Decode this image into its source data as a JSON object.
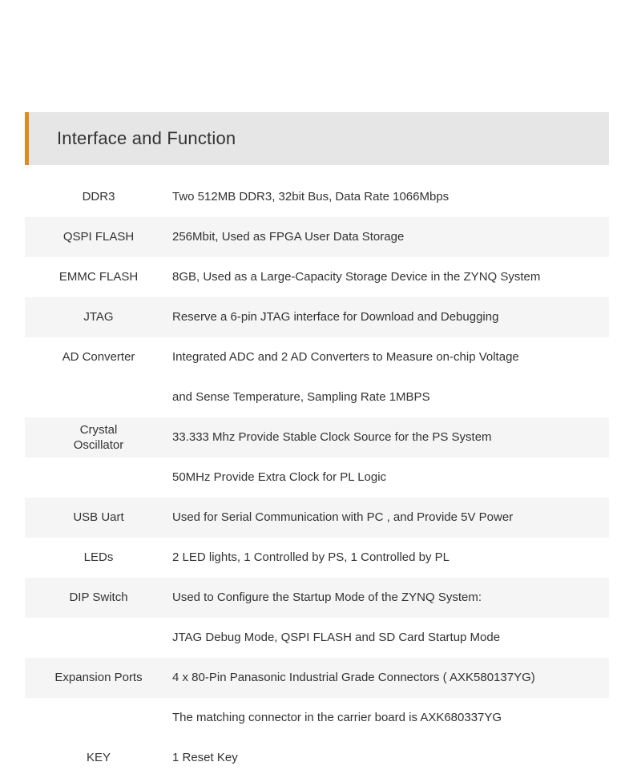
{
  "section": {
    "title": "Interface and Function",
    "accent_color": "#e08b1e",
    "header_bg": "#e6e6e6"
  },
  "table": {
    "stripe_colors": {
      "odd": "#ffffff",
      "even": "#f5f5f5"
    },
    "rows": [
      {
        "label": "DDR3",
        "value": "Two 512MB DDR3, 32bit Bus, Data Rate 1066Mbps",
        "stripe": "light"
      },
      {
        "label": "QSPI FLASH",
        "value": "256Mbit, Used as FPGA User Data Storage",
        "stripe": "gray"
      },
      {
        "label": "EMMC FLASH",
        "value": "8GB, Used as a Large-Capacity Storage Device in the ZYNQ System",
        "stripe": "light"
      },
      {
        "label": "JTAG",
        "value": "Reserve a 6-pin JTAG interface for  Download and Debugging",
        "stripe": "gray"
      },
      {
        "label": "AD Converter",
        "value": "Integrated ADC and 2 AD Converters to Measure on-chip Voltage",
        "stripe": "light"
      },
      {
        "label": "",
        "value": "and Sense Temperature, Sampling Rate 1MBPS",
        "stripe": "light"
      },
      {
        "label": "Crystal\nOscillator",
        "value": "33.333 Mhz  Provide Stable Clock Source for the PS System",
        "stripe": "gray"
      },
      {
        "label": "",
        "value": "50MHz Provide Extra Clock for PL Logic",
        "stripe": "light"
      },
      {
        "label": "USB Uart",
        "value": "Used for Serial Communication with PC , and Provide 5V Power",
        "stripe": "gray"
      },
      {
        "label": "LEDs",
        "value": "2 LED lights, 1 Controlled by PS, 1 Controlled by PL",
        "stripe": "light"
      },
      {
        "label": "DIP Switch",
        "value": "Used to Configure the Startup Mode of the ZYNQ System:",
        "stripe": "gray"
      },
      {
        "label": "",
        "value": "JTAG Debug Mode, QSPI FLASH and SD Card Startup Mode",
        "stripe": "light"
      },
      {
        "label": "Expansion Ports",
        "value": "4 x 80-Pin Panasonic Industrial Grade Connectors ( AXK580137YG)",
        "stripe": "gray"
      },
      {
        "label": "",
        "value": "The matching connector in the carrier board is  AXK680337YG",
        "stripe": "light"
      },
      {
        "label": "KEY",
        "value": "1 Reset Key",
        "stripe": "light"
      }
    ]
  }
}
